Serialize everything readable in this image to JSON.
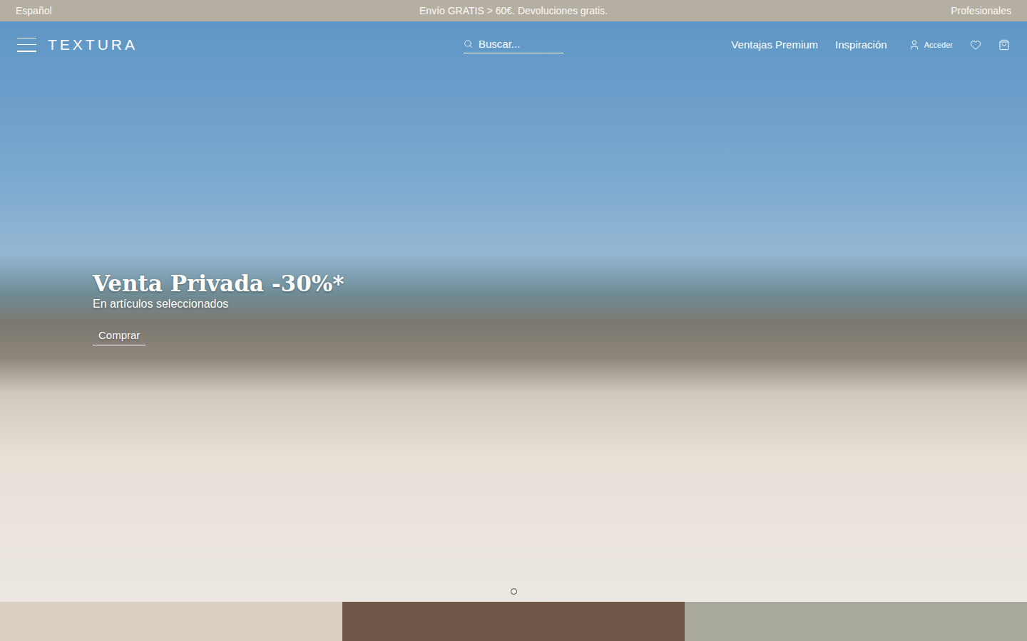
{
  "announcement_bar": {
    "language": "Español",
    "message": "Envío GRATIS > 60€. Devoluciones gratis.",
    "link": "Profesionales"
  },
  "header": {
    "logo": "TEXTURA",
    "search": {
      "placeholder": "Buscar..."
    },
    "nav": [
      "Ventajas Premium",
      "Inspiración"
    ],
    "account": "Acceder"
  },
  "hero": {
    "title": "Venta Privada -30%*",
    "subtitle": "En artículos seleccionados",
    "button": "Comprar",
    "dots": [
      {
        "selected": true
      }
    ]
  }
}
